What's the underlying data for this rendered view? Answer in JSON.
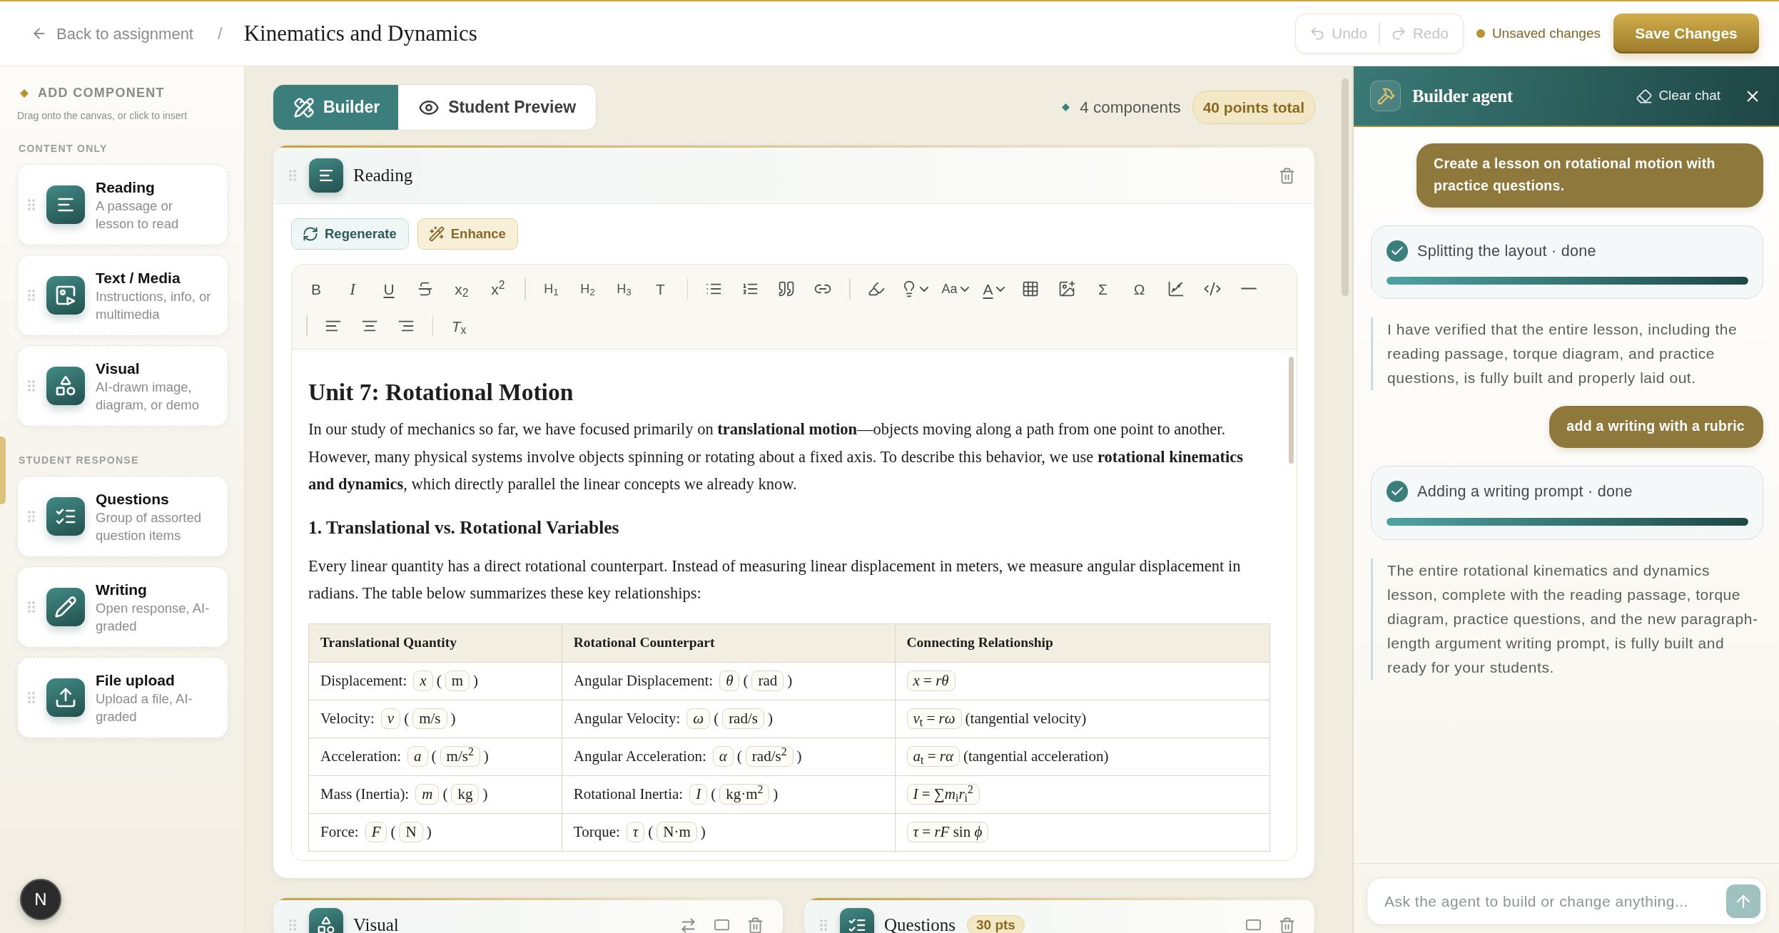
{
  "header": {
    "back_link": "Back to assignment",
    "separator": "/",
    "title": "Kinematics and Dynamics",
    "history": [
      {
        "kind": "undo",
        "label": "Undo",
        "disabled": true
      },
      {
        "kind": "redo",
        "label": "Redo",
        "disabled": true
      }
    ],
    "save_status": "Unsaved changes",
    "save_button": "Save Changes"
  },
  "sidebar": {
    "title": "ADD COMPONENT",
    "hint": "Drag onto the canvas, or click to insert",
    "groups": [
      {
        "label": "CONTENT ONLY",
        "items": [
          {
            "kind": "reading",
            "title": "Reading",
            "description": "A passage or lesson to read"
          },
          {
            "kind": "media",
            "title": "Text / Media",
            "description": "Instructions, info, or multimedia"
          },
          {
            "kind": "visual",
            "title": "Visual",
            "description": "AI-drawn image, diagram, or demo"
          }
        ]
      },
      {
        "label": "STUDENT RESPONSE",
        "items": [
          {
            "kind": "questions",
            "title": "Questions",
            "description": "Group of assorted question items"
          },
          {
            "kind": "writing",
            "title": "Writing",
            "description": "Open response, AI-graded"
          },
          {
            "kind": "upload",
            "title": "File upload",
            "description": "Upload a file, AI-graded"
          }
        ]
      }
    ],
    "dev_button": "N"
  },
  "canvas": {
    "tabs": [
      {
        "kind": "builder",
        "label": "Builder",
        "selected": true
      },
      {
        "kind": "preview",
        "label": "Student Preview",
        "selected": false
      }
    ],
    "component_count": "4 components",
    "points_total": "40 points total",
    "components": [
      {
        "kind": "reading",
        "title": "Reading",
        "actions": [
          {
            "kind": "regenerate",
            "label": "Regenerate"
          },
          {
            "kind": "enhance",
            "label": "Enhance"
          }
        ],
        "toolbar": [
          [
            {
              "kind": "bold",
              "label": "B"
            },
            {
              "kind": "italic",
              "label": "I"
            },
            {
              "kind": "underline",
              "label": "U"
            },
            {
              "kind": "strike"
            },
            {
              "kind": "subscript",
              "label": "x$_{2}$"
            },
            {
              "kind": "superscript",
              "label": "x$^{2}$"
            },
            {
              "kind": "separator"
            },
            {
              "kind": "heading",
              "label": "H$_{1}$"
            },
            {
              "kind": "heading",
              "label": "H$_{2}$"
            },
            {
              "kind": "heading",
              "label": "H$_{3}$"
            },
            {
              "kind": "paragraph",
              "label": "T"
            },
            {
              "kind": "separator"
            },
            {
              "kind": "bullet-list"
            },
            {
              "kind": "ordered-list"
            },
            {
              "kind": "blockquote"
            },
            {
              "kind": "link"
            },
            {
              "kind": "separator"
            },
            {
              "kind": "highlight"
            },
            {
              "kind": "callout",
              "menu": true
            },
            {
              "kind": "font-size",
              "label": "Aa",
              "menu": true
            },
            {
              "kind": "text-color",
              "label": "A",
              "menu": true
            },
            {
              "kind": "table"
            },
            {
              "kind": "image"
            },
            {
              "kind": "formula",
              "label": "Σ"
            },
            {
              "kind": "symbol",
              "label": "Ω"
            },
            {
              "kind": "graph"
            },
            {
              "kind": "code"
            },
            {
              "kind": "horizontal-rule"
            }
          ],
          [
            {
              "kind": "separator"
            },
            {
              "kind": "align-left"
            },
            {
              "kind": "align-center"
            },
            {
              "kind": "align-right"
            },
            {
              "kind": "separator"
            },
            {
              "kind": "clear-format",
              "label": "*T*$_{x}$"
            }
          ]
        ],
        "document": [
          {
            "kind": "heading",
            "text": "Unit 7: Rotational Motion"
          },
          {
            "kind": "paragraph",
            "text": "In our study of mechanics so far, we have focused primarily on **translational motion**—objects moving along a path from one point to another. However, many physical systems involve objects spinning or rotating about a fixed axis. To describe this behavior, we use **rotational kinematics and dynamics**, which directly parallel the linear concepts we already know."
          },
          {
            "kind": "subheading",
            "text": "1. Translational vs. Rotational Variables"
          },
          {
            "kind": "paragraph",
            "text": "Every linear quantity has a direct rotational counterpart. Instead of measuring linear displacement in meters, we measure angular displacement in radians. The table below summarizes these key relationships:"
          },
          {
            "kind": "table",
            "columns": [
              "Translational Quantity",
              "Rotational Counterpart",
              "Connecting Relationship"
            ],
            "rows": [
              [
                [
                  {
                    "kind": "text",
                    "text": "Displacement:"
                  },
                  {
                    "kind": "var",
                    "text": "x"
                  },
                  {
                    "kind": "text",
                    "text": "("
                  },
                  {
                    "kind": "unit",
                    "text": "m"
                  },
                  {
                    "kind": "text",
                    "text": ")"
                  }
                ],
                [
                  {
                    "kind": "text",
                    "text": "Angular Displacement:"
                  },
                  {
                    "kind": "var",
                    "text": "θ"
                  },
                  {
                    "kind": "text",
                    "text": "("
                  },
                  {
                    "kind": "unit",
                    "text": "rad"
                  },
                  {
                    "kind": "text",
                    "text": ")"
                  }
                ],
                [
                  {
                    "kind": "formula",
                    "text": "*x* = *rθ*"
                  }
                ]
              ],
              [
                [
                  {
                    "kind": "text",
                    "text": "Velocity:"
                  },
                  {
                    "kind": "var",
                    "text": "v"
                  },
                  {
                    "kind": "text",
                    "text": "("
                  },
                  {
                    "kind": "unit",
                    "text": "m/s"
                  },
                  {
                    "kind": "text",
                    "text": ")"
                  }
                ],
                [
                  {
                    "kind": "text",
                    "text": "Angular Velocity:"
                  },
                  {
                    "kind": "var",
                    "text": "ω"
                  },
                  {
                    "kind": "text",
                    "text": "("
                  },
                  {
                    "kind": "unit",
                    "text": "rad/s"
                  },
                  {
                    "kind": "text",
                    "text": ")"
                  }
                ],
                [
                  {
                    "kind": "formula",
                    "text": "*v*$_{t}$ = *rω*"
                  },
                  {
                    "kind": "text",
                    "text": "(tangential velocity)"
                  }
                ]
              ],
              [
                [
                  {
                    "kind": "text",
                    "text": "Acceleration:"
                  },
                  {
                    "kind": "var",
                    "text": "a"
                  },
                  {
                    "kind": "text",
                    "text": "("
                  },
                  {
                    "kind": "unit",
                    "text": "m/s$^{2}$"
                  },
                  {
                    "kind": "text",
                    "text": ")"
                  }
                ],
                [
                  {
                    "kind": "text",
                    "text": "Angular Acceleration:"
                  },
                  {
                    "kind": "var",
                    "text": "α"
                  },
                  {
                    "kind": "text",
                    "text": "("
                  },
                  {
                    "kind": "unit",
                    "text": "rad/s$^{2}$"
                  },
                  {
                    "kind": "text",
                    "text": ")"
                  }
                ],
                [
                  {
                    "kind": "formula",
                    "text": "*a*$_{t}$ = *rα*"
                  },
                  {
                    "kind": "text",
                    "text": "(tangential acceleration)"
                  }
                ]
              ],
              [
                [
                  {
                    "kind": "text",
                    "text": "Mass (Inertia):"
                  },
                  {
                    "kind": "var",
                    "text": "m"
                  },
                  {
                    "kind": "text",
                    "text": "("
                  },
                  {
                    "kind": "unit",
                    "text": "kg"
                  },
                  {
                    "kind": "text",
                    "text": ")"
                  }
                ],
                [
                  {
                    "kind": "text",
                    "text": "Rotational Inertia:"
                  },
                  {
                    "kind": "var",
                    "text": "I"
                  },
                  {
                    "kind": "text",
                    "text": "("
                  },
                  {
                    "kind": "unit",
                    "text": "kg·m$^{2}$"
                  },
                  {
                    "kind": "text",
                    "text": ")"
                  }
                ],
                [
                  {
                    "kind": "formula",
                    "text": "*I* = ∑*m*$_{i}$*r*$_{i}$$^{2}$"
                  }
                ]
              ],
              [
                [
                  {
                    "kind": "text",
                    "text": "Force:"
                  },
                  {
                    "kind": "var",
                    "text": "F"
                  },
                  {
                    "kind": "text",
                    "text": "("
                  },
                  {
                    "kind": "unit",
                    "text": "N"
                  },
                  {
                    "kind": "text",
                    "text": ")"
                  }
                ],
                [
                  {
                    "kind": "text",
                    "text": "Torque:"
                  },
                  {
                    "kind": "var",
                    "text": "τ"
                  },
                  {
                    "kind": "text",
                    "text": "("
                  },
                  {
                    "kind": "unit",
                    "text": "N·m"
                  },
                  {
                    "kind": "text",
                    "text": ")"
                  }
                ],
                [
                  {
                    "kind": "formula",
                    "text": "*τ* = *rF* sin *ϕ*"
                  }
                ]
              ]
            ]
          }
        ]
      },
      {
        "kind": "visual",
        "title": "Visual"
      },
      {
        "kind": "questions",
        "title": "Questions",
        "points": "30 pts"
      }
    ]
  },
  "agent": {
    "title": "Builder agent",
    "clear_button": "Clear chat",
    "messages": [
      {
        "kind": "user",
        "text": "Create a lesson on rotational motion with practice questions."
      },
      {
        "kind": "status",
        "text": "Splitting the layout · done",
        "level": 1
      },
      {
        "kind": "agent",
        "text": "I have verified that the entire lesson, including the reading passage, torque diagram, and practice questions, is fully built and properly laid out."
      },
      {
        "kind": "user",
        "text": "add a writing with a rubric"
      },
      {
        "kind": "status",
        "text": "Adding a writing prompt · done",
        "level": 1
      },
      {
        "kind": "agent",
        "text": "The entire rotational kinematics and dynamics lesson, complete with the reading passage, torque diagram, practice questions, and the new paragraph-length argument writing prompt, is fully built and ready for your students."
      }
    ],
    "input": {
      "placeholder": "Ask the agent to build or change anything..."
    }
  }
}
